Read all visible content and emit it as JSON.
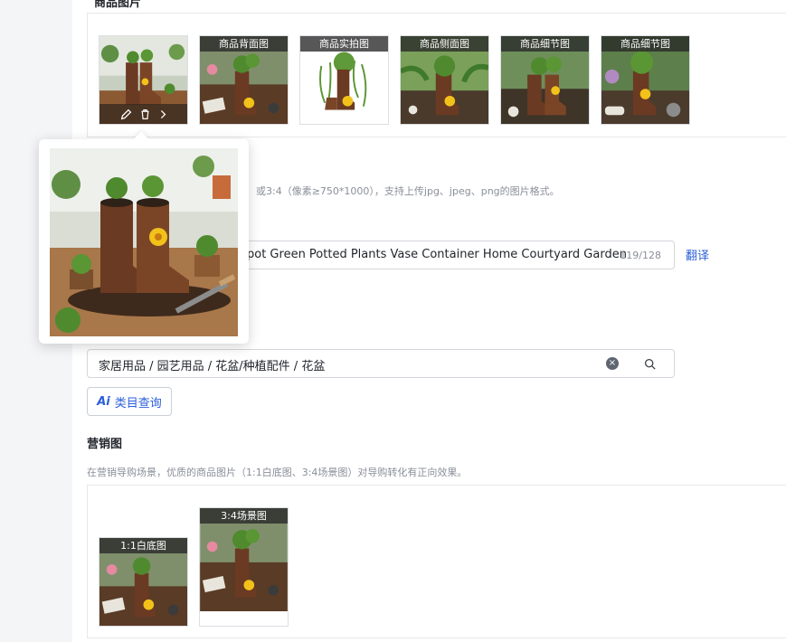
{
  "product_images": {
    "section_title": "商品图片",
    "items": [
      {
        "label": ""
      },
      {
        "label": "商品背面图"
      },
      {
        "label": "商品实拍图"
      },
      {
        "label": "商品侧面图"
      },
      {
        "label": "商品细节图"
      },
      {
        "label": "商品细节图"
      }
    ]
  },
  "hint_text": "或3:4（像素≥750*1000），支持上传jpg、jpeg、png的图片格式。",
  "title_field": {
    "value": "pot Green Potted Plants Vase Container Home Courtyard Garden",
    "count": "119/128",
    "translate_label": "翻译"
  },
  "category": {
    "value": "家居用品 / 园艺用品 / 花盆/种植配件 / 花盆",
    "ai_label": "类目查询",
    "ai_mark": "Ai"
  },
  "marketing": {
    "title": "营销图",
    "description": "在营销导购场景，优质的商品图片（1:1白底图、3:4场景图）对导购转化有正向效果。",
    "items": [
      {
        "label": "1:1白底图"
      },
      {
        "label": "3:4场景图"
      }
    ]
  },
  "colors": {
    "accent": "#2b5fd9",
    "boot": "#6b3a22",
    "leaf": "#4f8a2e",
    "flower": "#f2c21a",
    "wood": "#8b5a33"
  }
}
